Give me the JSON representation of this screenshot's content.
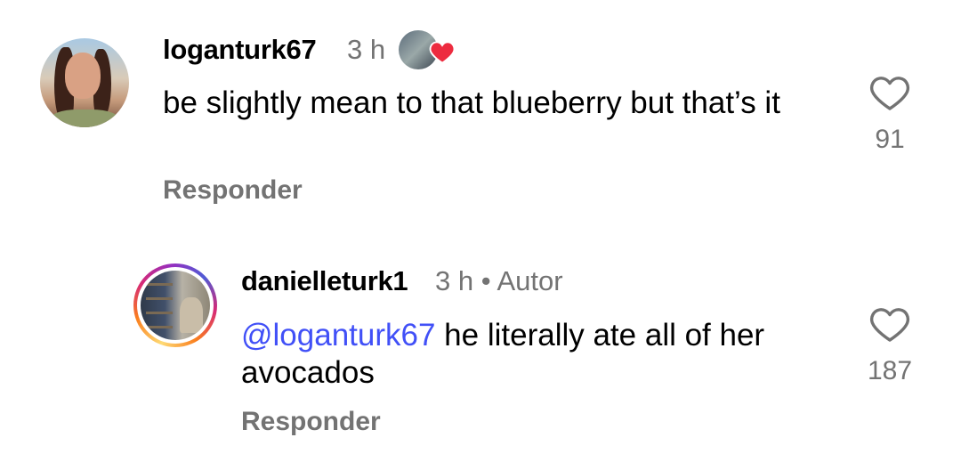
{
  "comments": [
    {
      "username": "loganturk67",
      "time": "3 h",
      "text": "be slightly mean to that blueberry but that’s it",
      "reply_label": "Responder",
      "like_count": "91",
      "liked_by_author": true
    },
    {
      "username": "danielleturk1",
      "time": "3 h",
      "separator": "•",
      "author_label": "Autor",
      "mention": "@loganturk67",
      "text": " he literally ate all of her avocados",
      "reply_label": "Responder",
      "like_count": "187",
      "has_story_ring": true
    }
  ],
  "colors": {
    "secondary_text": "#737373",
    "mention": "#4150f7",
    "heart_red": "#ed2b3f"
  },
  "icons": {
    "like": "heart-outline-icon",
    "author_liked": "heart-filled-icon"
  }
}
